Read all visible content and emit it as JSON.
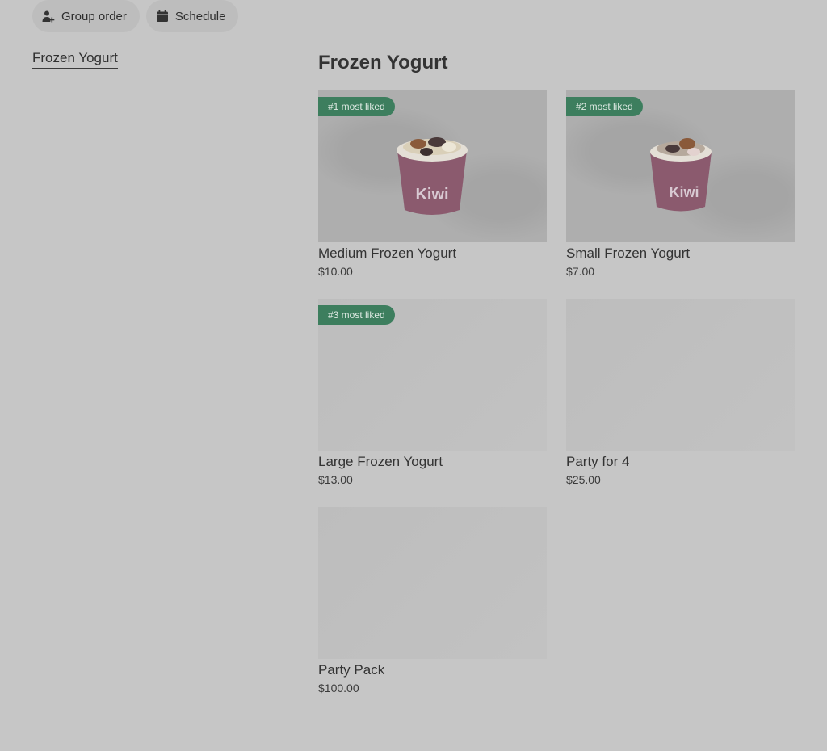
{
  "toolbar": {
    "group_order_label": "Group order",
    "schedule_label": "Schedule"
  },
  "sidebar": {
    "items": [
      {
        "label": "Frozen Yogurt"
      }
    ]
  },
  "section": {
    "title": "Frozen Yogurt",
    "items": [
      {
        "name": "Medium Frozen Yogurt",
        "price": "$10.00",
        "badge": "#1 most liked",
        "has_photo": true
      },
      {
        "name": "Small Frozen Yogurt",
        "price": "$7.00",
        "badge": "#2 most liked",
        "has_photo": true
      },
      {
        "name": "Large Frozen Yogurt",
        "price": "$13.00",
        "badge": "#3 most liked",
        "has_photo": false
      },
      {
        "name": "Party for 4",
        "price": "$25.00",
        "badge": "",
        "has_photo": false
      },
      {
        "name": "Party Pack",
        "price": "$100.00",
        "badge": "",
        "has_photo": false
      }
    ]
  },
  "photo_logo_text": "Kiwi",
  "colors": {
    "badge": "#3d7e5e",
    "overlay_background": "#c6c6c6"
  },
  "icons": {
    "group_order": "person-add-icon",
    "schedule": "calendar-icon"
  }
}
